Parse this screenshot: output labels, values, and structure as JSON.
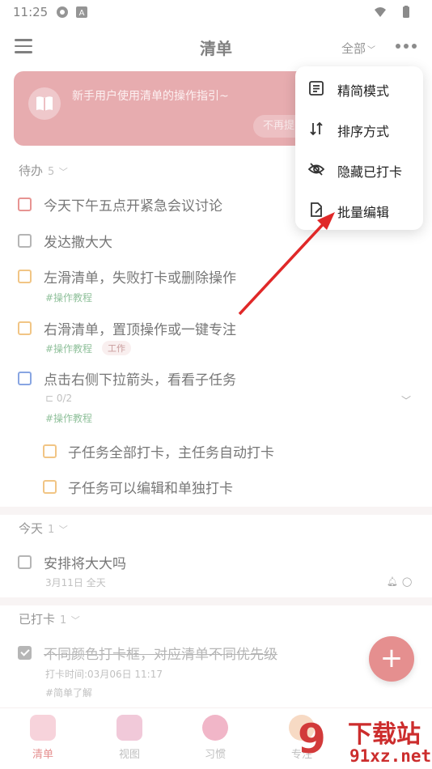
{
  "status": {
    "time": "11:25"
  },
  "header": {
    "title": "清单",
    "filter": "全部"
  },
  "banner": {
    "text": "新手用户使用清单的操作指引~",
    "button": "不再提"
  },
  "sections": {
    "todo": {
      "label": "待办",
      "count": "5"
    },
    "today": {
      "label": "今天",
      "count": "1"
    },
    "done": {
      "label": "已打卡",
      "count": "1"
    }
  },
  "tasks": [
    {
      "text": "今天下午五点开紧急会议讨论"
    },
    {
      "text": "发达撒大大"
    },
    {
      "text": "左滑清单，失败打卡或删除操作",
      "tag": "#操作教程"
    },
    {
      "text": "右滑清单，置顶操作或一键专注",
      "tag": "#操作教程",
      "label": "工作"
    },
    {
      "text": "点击右侧下拉箭头，看看子任务",
      "sub": "0/2",
      "tag": "#操作教程"
    },
    {
      "text": "子任务全部打卡，主任务自动打卡"
    },
    {
      "text": "子任务可以编辑和单独打卡"
    }
  ],
  "today_task": {
    "text": "安排将大大吗",
    "date": "3月11日 全天"
  },
  "done_task": {
    "text": "不同颜色打卡框，对应清单不同优先级",
    "time": "打卡时间:03月06日 11:17",
    "tag": "#简单了解"
  },
  "nav": [
    {
      "label": "清单"
    },
    {
      "label": "视图"
    },
    {
      "label": "习惯"
    },
    {
      "label": "专注"
    }
  ],
  "menu": [
    {
      "label": "精简模式",
      "icon": "list-icon"
    },
    {
      "label": "排序方式",
      "icon": "sort-icon"
    },
    {
      "label": "隐藏已打卡",
      "icon": "eye-off-icon"
    },
    {
      "label": "批量编辑",
      "icon": "edit-document-icon"
    }
  ],
  "watermark": {
    "text": "下载站",
    "domain": "91xz.net"
  },
  "colors": {
    "accent": "#d64b4b",
    "banner": "#d9797f",
    "green_tag": "#4a9a5c"
  }
}
